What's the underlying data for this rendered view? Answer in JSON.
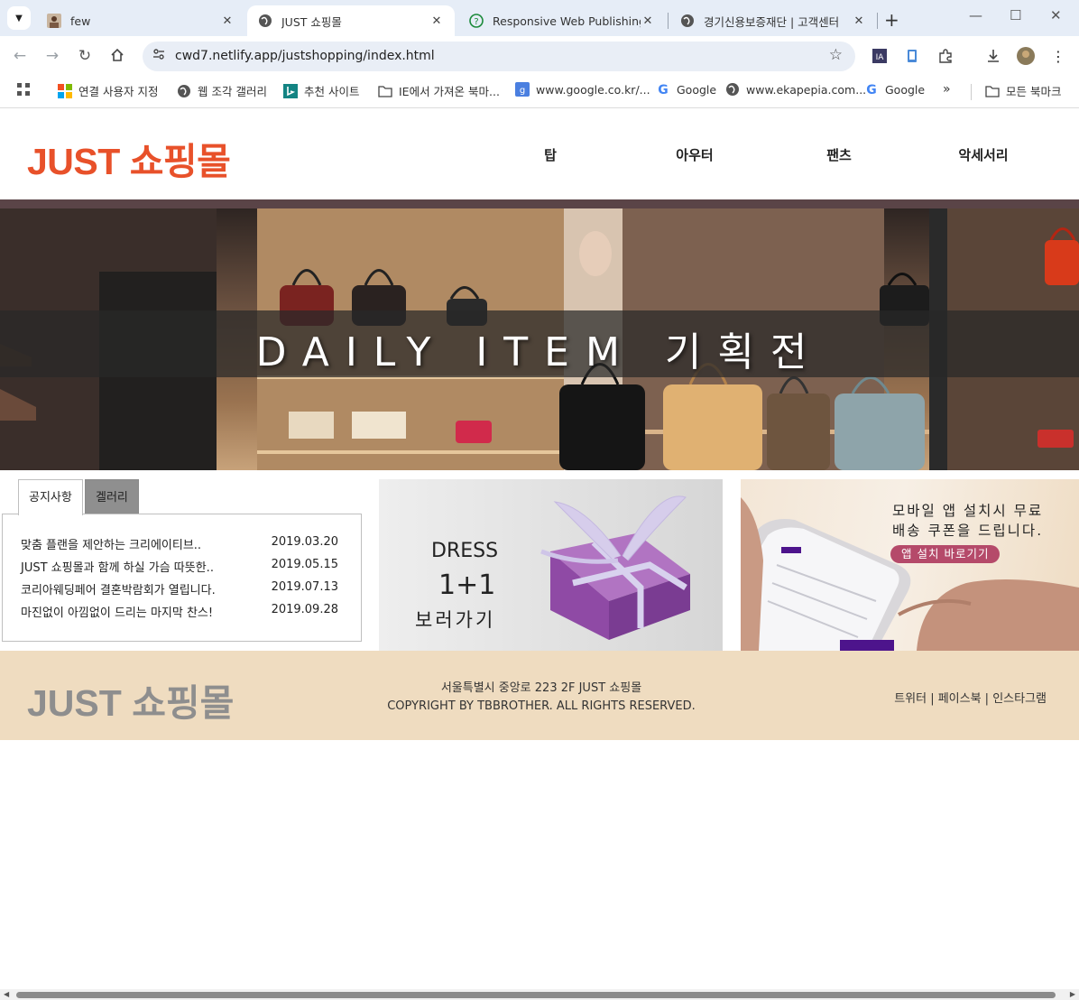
{
  "browser": {
    "tabs": [
      {
        "title": "few",
        "active": false
      },
      {
        "title": "JUST 쇼핑몰",
        "active": true
      },
      {
        "title": "Responsive Web Publishing",
        "active": false
      },
      {
        "title": "경기신용보증재단 | 고객센터",
        "active": false
      }
    ],
    "url": "cwd7.netlify.app/justshopping/index.html",
    "bookmarks": [
      "연결 사용자 지정",
      "웹 조각 갤러리",
      "추천 사이트",
      "IE에서 가져온 북마...",
      "www.google.co.kr/...",
      "Google",
      "www.ekapepia.com...",
      "Google",
      "모든 북마크"
    ]
  },
  "site": {
    "logo": "JUST 쇼핑몰",
    "nav": [
      "탑",
      "아우터",
      "팬츠",
      "악세서리"
    ],
    "hero_title": "DAILY ITEM 기획전",
    "notice": {
      "tabs": [
        "공지사항",
        "겔러리"
      ],
      "items": [
        {
          "title": "맞춤 플랜을 제안하는 크리에이티브..",
          "date": "2019.03.20"
        },
        {
          "title": "JUST 쇼핑몰과 함께 하실 가슴 따뜻한..",
          "date": "2019.05.15"
        },
        {
          "title": "코리아웨딩페어 결혼박람회가 열립니다.",
          "date": "2019.07.13"
        },
        {
          "title": "마진없이 아낌없이 드리는 마지막 찬스!",
          "date": "2019.09.28"
        }
      ]
    },
    "promo_dress": {
      "line1": "DRESS",
      "line2": "1+1",
      "line3": "보러가기"
    },
    "promo_app": {
      "line1": "모바일 앱 설치시 무료",
      "line2": "배송 쿠폰을 드립니다.",
      "button": "앱 설치 바로기기"
    },
    "footer": {
      "logo": "JUST 쇼핑몰",
      "address": "서울특별시 중앙로 223 2F JUST 쇼핑몰",
      "copyright": "COPYRIGHT BY TBBROTHER. ALL RIGHTS RESERVED.",
      "links": "트위터 | 페이스북 | 인스타그램"
    }
  },
  "colors": {
    "brand": "#e8512a",
    "footer_bg": "#efdcc0",
    "app_button": "#b54a6a"
  }
}
